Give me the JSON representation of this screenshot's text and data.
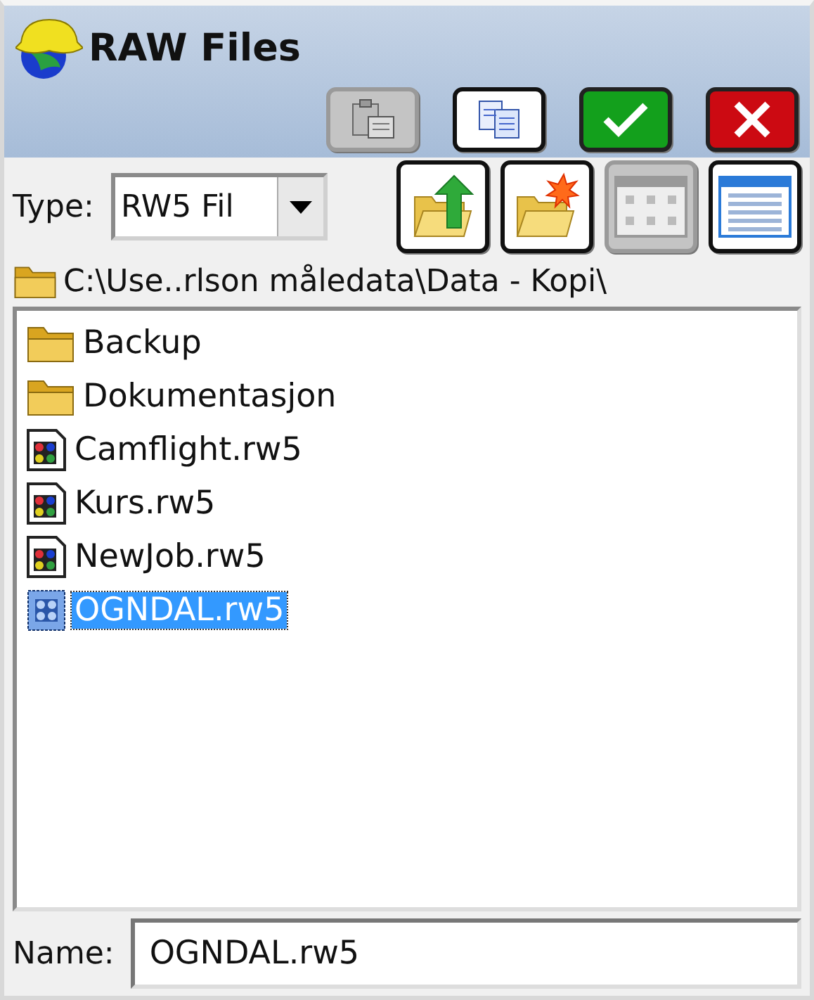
{
  "window": {
    "title": "RAW Files"
  },
  "toolbar": [
    {
      "kind": "paste",
      "disabled": true
    },
    {
      "kind": "copy",
      "disabled": false
    },
    {
      "kind": "ok",
      "disabled": false
    },
    {
      "kind": "cancel",
      "disabled": false
    }
  ],
  "type_field": {
    "label": "Type:",
    "value": "RW5 Fil"
  },
  "actions": [
    {
      "kind": "up-folder",
      "disabled": false
    },
    {
      "kind": "new-folder",
      "disabled": false
    },
    {
      "kind": "icon-view",
      "disabled": true
    },
    {
      "kind": "list-view",
      "disabled": false
    }
  ],
  "path": "C:\\Use..rlson måledata\\Data - Kopi\\",
  "files": [
    {
      "name": "Backup",
      "kind": "folder",
      "selected": false
    },
    {
      "name": "Dokumentasjon",
      "kind": "folder",
      "selected": false
    },
    {
      "name": "Camflight.rw5",
      "kind": "rw5",
      "selected": false
    },
    {
      "name": "Kurs.rw5",
      "kind": "rw5",
      "selected": false
    },
    {
      "name": "NewJob.rw5",
      "kind": "rw5",
      "selected": false
    },
    {
      "name": "OGNDAL.rw5",
      "kind": "rw5",
      "selected": true
    }
  ],
  "name_field": {
    "label": "Name:",
    "value": "OGNDAL.rw5"
  }
}
